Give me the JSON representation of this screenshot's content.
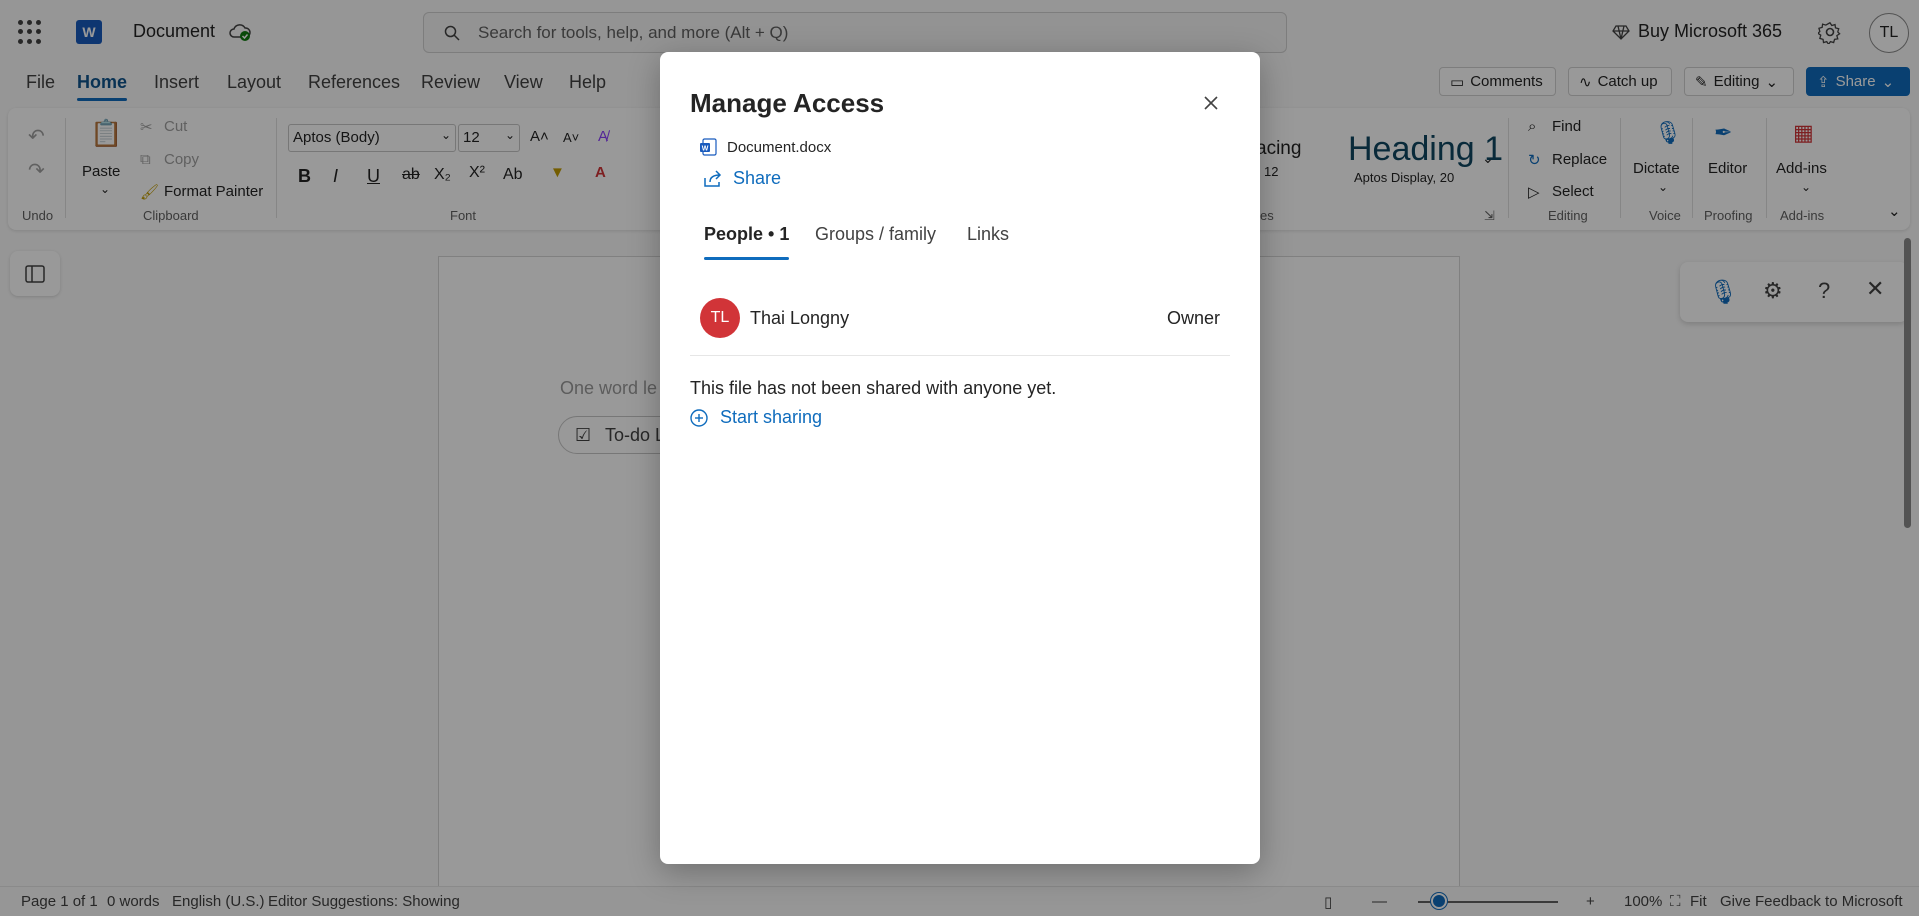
{
  "titlebar": {
    "doc_title": "Document",
    "search_placeholder": "Search for tools, help, and more (Alt + Q)",
    "buy_label": "Buy Microsoft 365",
    "user_initials": "TL",
    "app_letter": "W"
  },
  "menu": {
    "tabs": [
      {
        "label": "File"
      },
      {
        "label": "Home"
      },
      {
        "label": "Insert"
      },
      {
        "label": "Layout"
      },
      {
        "label": "References"
      },
      {
        "label": "Review"
      },
      {
        "label": "View"
      },
      {
        "label": "Help"
      }
    ],
    "active_tab": "Home",
    "comments_label": "Comments",
    "catchup_label": "Catch up",
    "editing_label": "Editing",
    "share_label": "Share"
  },
  "ribbon": {
    "undo_group": "Undo",
    "paste": "Paste",
    "cut": "Cut",
    "copy": "Copy",
    "format_painter": "Format Painter",
    "clipboard_group": "Clipboard",
    "font_name": "Aptos (Body)",
    "font_size": "12",
    "font_group": "Font",
    "styles_spacing": "acing",
    "styles_spacing_sub": "12",
    "heading1": "Heading 1",
    "heading1_sub": "Aptos Display, 20",
    "styles_group": "es",
    "find": "Find",
    "replace": "Replace",
    "select": "Select",
    "editing_group": "Editing",
    "dictate": "Dictate",
    "voice_group": "Voice",
    "editor": "Editor",
    "proofing_group": "Proofing",
    "addins": "Add-ins",
    "addins_group": "Add-ins"
  },
  "document": {
    "hint": "One word le",
    "todo": "To-do L"
  },
  "statusbar": {
    "page": "Page 1 of 1",
    "words": "0 words",
    "language": "English (U.S.)",
    "editor": "Editor Suggestions: Showing",
    "zoom": "100%",
    "fit": "Fit",
    "feedback": "Give Feedback to Microsoft",
    "zoom_level": 0.15
  },
  "dialog": {
    "title": "Manage Access",
    "file_name": "Document.docx",
    "share_label": "Share",
    "tabs": [
      {
        "label": "People • 1"
      },
      {
        "label": "Groups / family"
      },
      {
        "label": "Links"
      }
    ],
    "people": [
      {
        "initials": "TL",
        "name": "Thai Longny",
        "role": "Owner",
        "avatar_color": "#d13438"
      }
    ],
    "empty_message": "This file has not been shared with anyone yet.",
    "start_sharing": "Start sharing"
  },
  "colors": {
    "accent": "#0f6cbd",
    "word_brand": "#185abd",
    "avatar": "#d13438"
  }
}
